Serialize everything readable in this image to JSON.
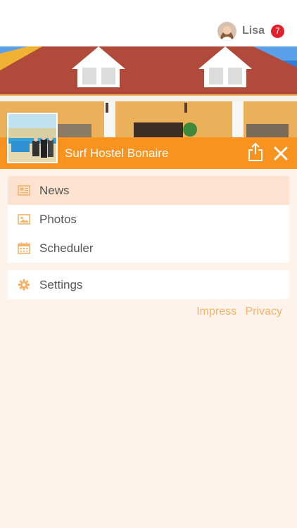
{
  "user": {
    "name": "Lisa",
    "notification_count": "7"
  },
  "hostel": {
    "name": "Surf Hostel Bonaire"
  },
  "menu": {
    "main": [
      {
        "label": "News",
        "icon": "newspaper-icon",
        "active": true
      },
      {
        "label": "Photos",
        "icon": "image-icon",
        "active": false
      },
      {
        "label": "Scheduler",
        "icon": "calendar-icon",
        "active": false
      }
    ],
    "secondary": [
      {
        "label": "Settings",
        "icon": "gear-icon",
        "active": false
      }
    ]
  },
  "footer_links": {
    "impress": "Impress",
    "privacy": "Privacy"
  },
  "colors": {
    "accent": "#f7931e",
    "background": "#fdf3ea",
    "active_item": "#fde3cf",
    "badge": "#e0202a",
    "link": "#f5b26b"
  }
}
